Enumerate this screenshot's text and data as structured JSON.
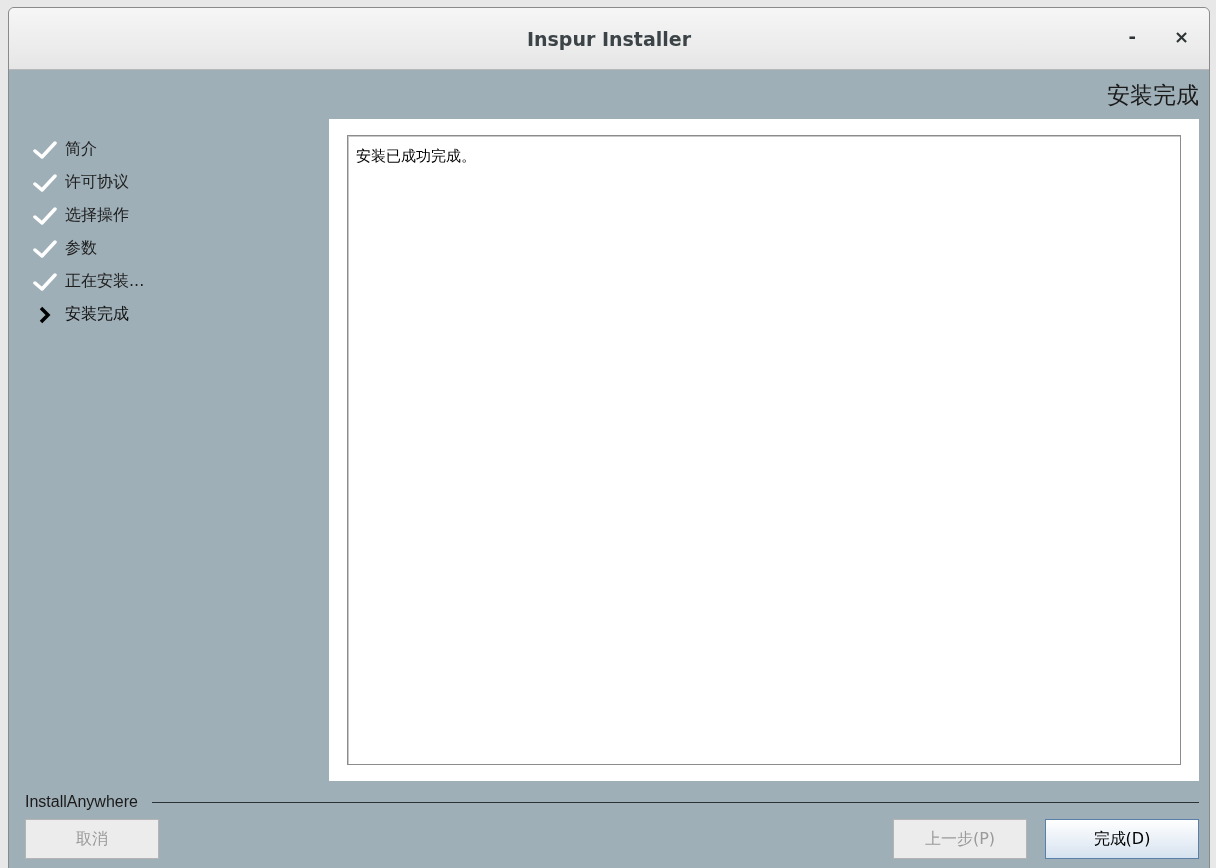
{
  "window": {
    "title": "Inspur Installer",
    "minimize": "-",
    "close": "×"
  },
  "heading": "安装完成",
  "steps": [
    {
      "label": "简介",
      "kind": "done"
    },
    {
      "label": "许可协议",
      "kind": "done"
    },
    {
      "label": "选择操作",
      "kind": "done"
    },
    {
      "label": "参数",
      "kind": "done"
    },
    {
      "label": "正在安装...",
      "kind": "done"
    },
    {
      "label": "安装完成",
      "kind": "current"
    }
  ],
  "message": "安装已成功完成。",
  "footer_label": "InstallAnywhere",
  "buttons": [
    {
      "label": "取消",
      "disabled": true,
      "default": false
    },
    {
      "label": "上一步(P)",
      "disabled": true,
      "default": false
    },
    {
      "label": "完成(D)",
      "disabled": false,
      "default": true
    }
  ]
}
